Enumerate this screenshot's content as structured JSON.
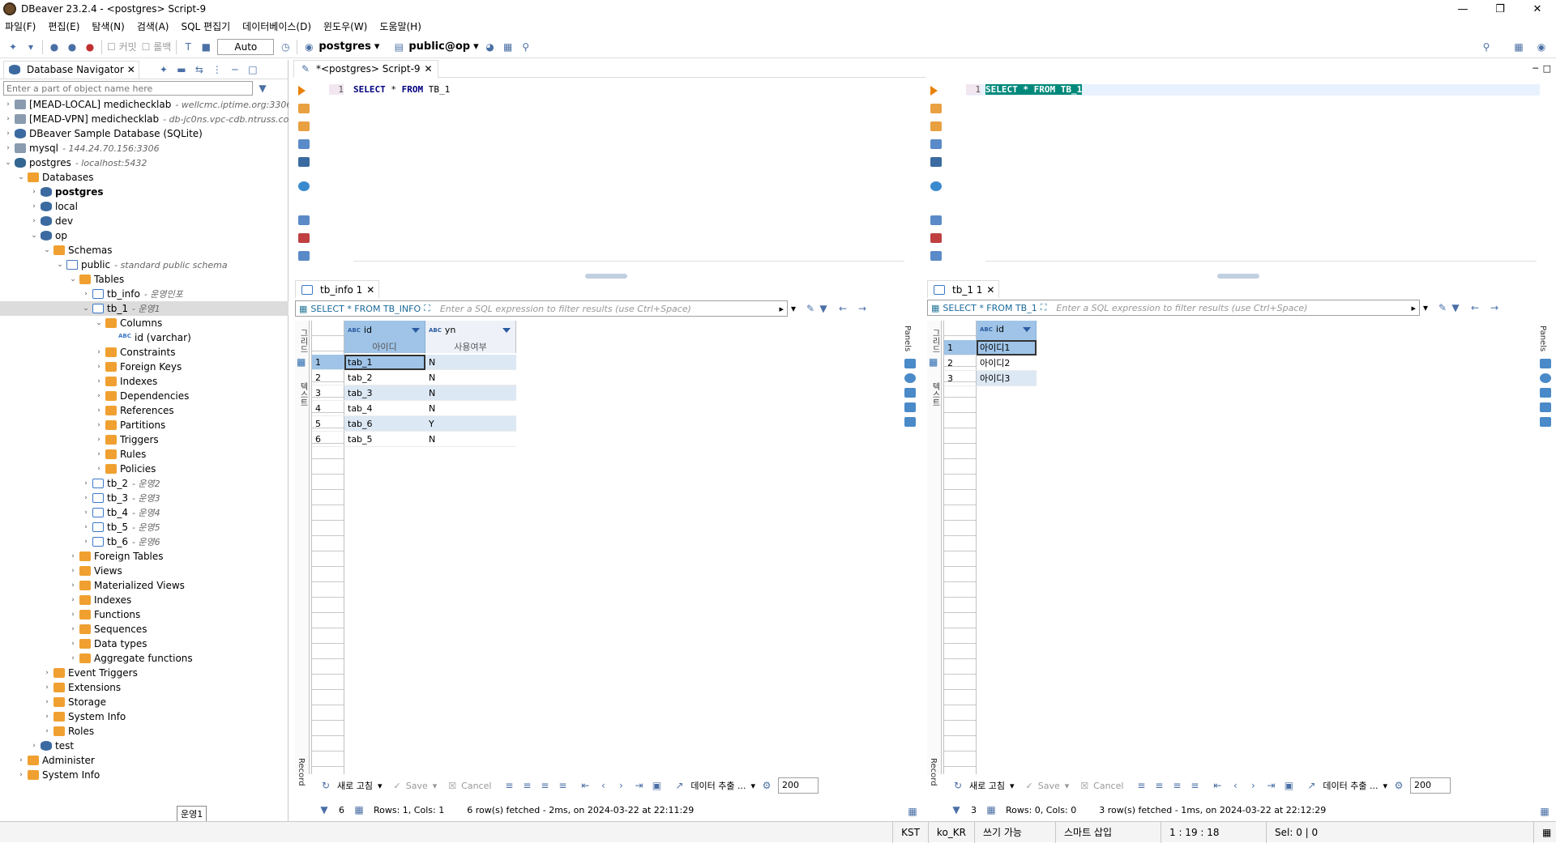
{
  "window": {
    "title": "DBeaver 23.2.4 - <postgres> Script-9"
  },
  "menu": [
    "파일(F)",
    "편집(E)",
    "탐색(N)",
    "검색(A)",
    "SQL 편집기",
    "데이터베이스(D)",
    "윈도우(W)",
    "도움말(H)"
  ],
  "toolbar": {
    "commit": "커밋",
    "rollback": "롤백",
    "auto": "Auto",
    "datasource": "postgres",
    "schema": "public@op"
  },
  "navigator": {
    "tab": "Database Navigator",
    "search_placeholder": "Enter a part of object name here",
    "tree": [
      {
        "label": "[MEAD-LOCAL] medichecklab",
        "sub": "- wellcmc.iptime.org:3306"
      },
      {
        "label": "[MEAD-VPN] medichecklab",
        "sub": "- db-jc0ns.vpc-cdb.ntruss.co"
      },
      {
        "label": "DBeaver Sample Database (SQLite)",
        "sub": ""
      },
      {
        "label": "mysql",
        "sub": "- 144.24.70.156:3306"
      },
      {
        "label": "postgres",
        "sub": "- localhost:5432"
      },
      {
        "label": "Databases",
        "sub": ""
      },
      {
        "label": "postgres",
        "sub": ""
      },
      {
        "label": "local",
        "sub": ""
      },
      {
        "label": "dev",
        "sub": ""
      },
      {
        "label": "op",
        "sub": ""
      },
      {
        "label": "Schemas",
        "sub": ""
      },
      {
        "label": "public",
        "sub": "- standard public schema"
      },
      {
        "label": "Tables",
        "sub": ""
      },
      {
        "label": "tb_info",
        "sub": "- 운영인포"
      },
      {
        "label": "tb_1",
        "sub": "- 운영1"
      },
      {
        "label": "Columns",
        "sub": ""
      },
      {
        "label": "id (varchar)",
        "sub": ""
      },
      {
        "label": "Constraints",
        "sub": ""
      },
      {
        "label": "Foreign Keys",
        "sub": ""
      },
      {
        "label": "Indexes",
        "sub": ""
      },
      {
        "label": "Dependencies",
        "sub": ""
      },
      {
        "label": "References",
        "sub": ""
      },
      {
        "label": "Partitions",
        "sub": ""
      },
      {
        "label": "Triggers",
        "sub": ""
      },
      {
        "label": "Rules",
        "sub": ""
      },
      {
        "label": "Policies",
        "sub": ""
      },
      {
        "label": "tb_2",
        "sub": "- 운영2"
      },
      {
        "label": "tb_3",
        "sub": "- 운영3"
      },
      {
        "label": "tb_4",
        "sub": "- 운영4"
      },
      {
        "label": "tb_5",
        "sub": "- 운영5"
      },
      {
        "label": "tb_6",
        "sub": "- 운영6"
      },
      {
        "label": "Foreign Tables",
        "sub": ""
      },
      {
        "label": "Views",
        "sub": ""
      },
      {
        "label": "Materialized Views",
        "sub": ""
      },
      {
        "label": "Indexes",
        "sub": ""
      },
      {
        "label": "Functions",
        "sub": ""
      },
      {
        "label": "Sequences",
        "sub": ""
      },
      {
        "label": "Data types",
        "sub": ""
      },
      {
        "label": "Aggregate functions",
        "sub": ""
      },
      {
        "label": "Event Triggers",
        "sub": ""
      },
      {
        "label": "Extensions",
        "sub": ""
      },
      {
        "label": "Storage",
        "sub": ""
      },
      {
        "label": "System Info",
        "sub": ""
      },
      {
        "label": "Roles",
        "sub": ""
      },
      {
        "label": "test",
        "sub": ""
      },
      {
        "label": "Administer",
        "sub": ""
      },
      {
        "label": "System Info",
        "sub": ""
      }
    ],
    "tooltip": "운영1"
  },
  "editor": {
    "tab": "*<postgres> Script-9",
    "left_line": "1",
    "left_code": [
      "SELECT",
      " * ",
      "FROM",
      " TB_1"
    ],
    "right_line": "1",
    "right_code": "SELECT * FROM TB_1"
  },
  "left_results": {
    "tab": "tb_info 1",
    "query": "SELECT * FROM TB_INFO",
    "filter_placeholder": "Enter a SQL expression to filter results (use Ctrl+Space)",
    "side_labels": {
      "grid": "그리드",
      "text": "텍스트",
      "record": "Record",
      "panels": "Panels"
    },
    "columns": [
      {
        "name": "id",
        "desc": "아이디"
      },
      {
        "name": "yn",
        "desc": "사용여부"
      }
    ],
    "rows": [
      [
        "tab_1",
        "N"
      ],
      [
        "tab_2",
        "N"
      ],
      [
        "tab_3",
        "N"
      ],
      [
        "tab_4",
        "N"
      ],
      [
        "tab_6",
        "Y"
      ],
      [
        "tab_5",
        "N"
      ]
    ],
    "row_numbers": [
      "1",
      "2",
      "3",
      "4",
      "5",
      "6"
    ],
    "bottom": {
      "refresh": "새로 고침",
      "save": "Save",
      "cancel": "Cancel",
      "export": "데이터 추출 ...",
      "fetch": "200"
    },
    "status": {
      "count": "6",
      "rows_cols": "Rows: 1, Cols: 1",
      "msg": "6 row(s) fetched - 2ms, on 2024-03-22 at 22:11:29"
    }
  },
  "right_results": {
    "tab": "tb_1 1",
    "query": "SELECT * FROM TB_1",
    "filter_placeholder": "Enter a SQL expression to filter results (use Ctrl+Space)",
    "side_labels": {
      "grid": "그리드",
      "text": "텍스트",
      "record": "Record",
      "panels": "Panels"
    },
    "columns": [
      {
        "name": "id",
        "desc": ""
      }
    ],
    "rows": [
      [
        "아이디1"
      ],
      [
        "아이디2"
      ],
      [
        "아이디3"
      ]
    ],
    "row_numbers": [
      "1",
      "2",
      "3"
    ],
    "bottom": {
      "refresh": "새로 고침",
      "save": "Save",
      "cancel": "Cancel",
      "export": "데이터 추출 ...",
      "fetch": "200"
    },
    "status": {
      "count": "3",
      "rows_cols": "Rows: 0, Cols: 0",
      "msg": "3 row(s) fetched - 1ms, on 2024-03-22 at 22:12:29"
    }
  },
  "statusbar": {
    "tz": "KST",
    "locale": "ko_KR",
    "mode": "쓰기 가능",
    "insert": "스마트 삽입",
    "pos": "1 : 19 : 18",
    "sel": "Sel: 0 | 0"
  }
}
